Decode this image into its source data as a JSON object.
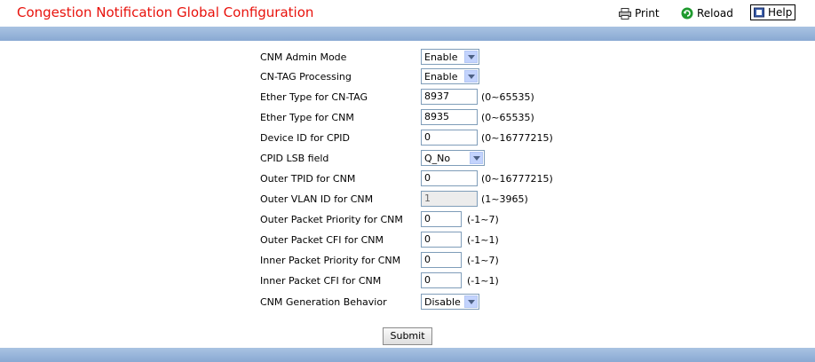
{
  "header": {
    "title": "Congestion Notification Global Configuration",
    "print_label": "Print",
    "reload_label": "Reload",
    "help_label": "Help"
  },
  "form": {
    "rows": [
      {
        "label": "CNM Admin Mode",
        "type": "select",
        "value": "Enable"
      },
      {
        "label": "CN-TAG Processing",
        "type": "select",
        "value": "Enable"
      },
      {
        "label": "Ether Type for CN-TAG",
        "type": "input",
        "value": "8937",
        "range": "(0~65535)"
      },
      {
        "label": "Ether Type for CNM",
        "type": "input",
        "value": "8935",
        "range": "(0~65535)"
      },
      {
        "label": "Device ID for CPID",
        "type": "input",
        "value": "0",
        "range": "(0~16777215)"
      },
      {
        "label": "CPID LSB field",
        "type": "select",
        "value": "Q_No"
      },
      {
        "label": "Outer TPID for CNM",
        "type": "input",
        "value": "0",
        "range": "(0~16777215)"
      },
      {
        "label": "Outer VLAN ID for CNM",
        "type": "input",
        "value": "1",
        "range": "(1~3965)",
        "disabled": true
      },
      {
        "label": "Outer Packet Priority for CNM",
        "type": "input",
        "value": "0",
        "range": "(-1~7)"
      },
      {
        "label": "Outer Packet CFI for CNM",
        "type": "input",
        "value": "0",
        "range": "(-1~1)"
      },
      {
        "label": "Inner Packet Priority for CNM",
        "type": "input",
        "value": "0",
        "range": "(-1~7)"
      },
      {
        "label": "Inner Packet CFI for CNM",
        "type": "input",
        "value": "0",
        "range": "(-1~1)"
      },
      {
        "label": "CNM Generation Behavior",
        "type": "select",
        "value": "Disable"
      }
    ],
    "submit_label": "Submit"
  },
  "colors": {
    "title": "#e8120c",
    "band": "#96b4da",
    "print_icon": "printer-icon",
    "reload_icon": "reload-icon",
    "help_icon": "help-book-icon"
  }
}
